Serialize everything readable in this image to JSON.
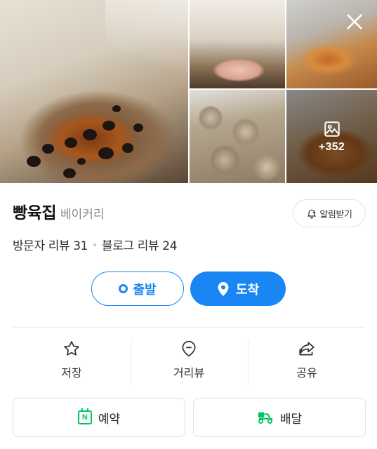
{
  "gallery": {
    "more_count": "+352",
    "icons": {
      "close": "close-icon",
      "more": "image-icon"
    },
    "overlay_color": "#000000"
  },
  "place": {
    "name": "빵육집",
    "category": "베이커리",
    "alert_label": "알림받기",
    "visitor_reviews": "방문자 리뷰 31",
    "blog_reviews": "블로그 리뷰 24"
  },
  "route": {
    "start_label": "출발",
    "arrive_label": "도착",
    "accent": "#1a86f4"
  },
  "actions": {
    "save_label": "저장",
    "street_label": "거리뷰",
    "share_label": "공유"
  },
  "bottom": {
    "reserve_label": "예약",
    "reserve_icon_text": "N",
    "delivery_label": "배달",
    "brand_green": "#03c75a"
  }
}
